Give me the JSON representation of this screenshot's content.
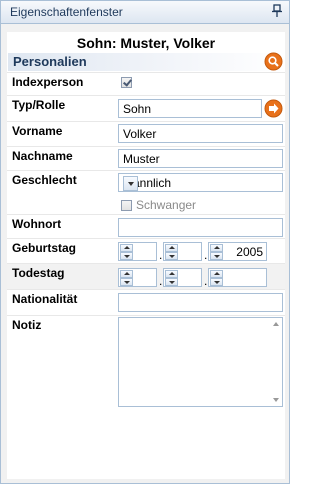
{
  "panel": {
    "title": "Eigenschaftenfenster"
  },
  "heading": "Sohn: Muster, Volker",
  "section": {
    "label": "Personalien"
  },
  "fields": {
    "indexperson": {
      "label": "Indexperson",
      "checked": true
    },
    "typ_rolle": {
      "label": "Typ/Rolle",
      "value": "Sohn"
    },
    "vorname": {
      "label": "Vorname",
      "value": "Volker"
    },
    "nachname": {
      "label": "Nachname",
      "value": "Muster"
    },
    "geschlecht": {
      "label": "Geschlecht",
      "value": "männlich"
    },
    "schwanger": {
      "label": "Schwanger",
      "checked": false
    },
    "wohnort": {
      "label": "Wohnort",
      "value": ""
    },
    "geburtstag": {
      "label": "Geburtstag",
      "day": "",
      "month": "",
      "year": "2005"
    },
    "todestag": {
      "label": "Todestag",
      "day": "",
      "month": "",
      "year": ""
    },
    "nationalitaet": {
      "label": "Nationalität",
      "value": ""
    },
    "notiz": {
      "label": "Notiz",
      "value": ""
    }
  },
  "colors": {
    "accent_orange": "#e8711b",
    "border_blue": "#a9bfd6",
    "title_text": "#1e395b"
  }
}
